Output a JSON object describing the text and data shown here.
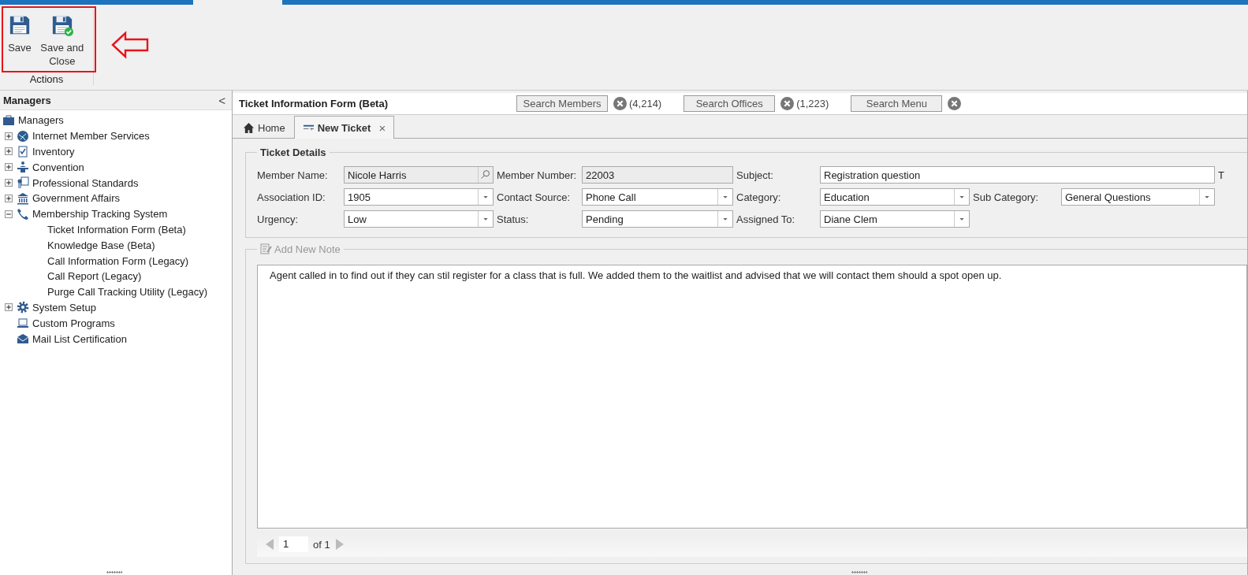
{
  "ribbon": {
    "buttons": [
      {
        "label": "Save",
        "kind": "save"
      },
      {
        "label": "Save and Close",
        "kind": "save-close"
      }
    ],
    "group_label": "Actions"
  },
  "sidebar": {
    "title": "Managers",
    "collapse_glyph": "<",
    "root": "Managers",
    "items": [
      {
        "label": "Internet Member Services",
        "expanded": false
      },
      {
        "label": "Inventory",
        "expanded": false
      },
      {
        "label": "Convention",
        "expanded": false
      },
      {
        "label": "Professional Standards",
        "expanded": false
      },
      {
        "label": "Government Affairs",
        "expanded": false
      },
      {
        "label": "Membership Tracking System",
        "expanded": true,
        "children": [
          {
            "label": "Ticket Information Form (Beta)"
          },
          {
            "label": "Knowledge Base (Beta)"
          },
          {
            "label": "Call Information Form (Legacy)"
          },
          {
            "label": "Call Report (Legacy)"
          },
          {
            "label": "Purge Call Tracking Utility (Legacy)"
          }
        ]
      },
      {
        "label": "System Setup",
        "expanded": false
      },
      {
        "label": "Custom Programs"
      },
      {
        "label": "Mail List Certification"
      }
    ]
  },
  "panel": {
    "title": "Ticket Information Form (Beta)",
    "searches": [
      {
        "label": "Search Members",
        "count": "(4,214)"
      },
      {
        "label": "Search Offices",
        "count": "(1,223)"
      },
      {
        "label": "Search Menu"
      }
    ],
    "tabs": [
      {
        "label": "Home",
        "selected": false
      },
      {
        "label": "New Ticket",
        "selected": true,
        "close_glyph": "×"
      }
    ],
    "ticket_details": {
      "title": "Ticket Details",
      "rows": [
        [
          {
            "label": "Member Name:",
            "value": "Nicole Harris",
            "kind": "lookup"
          },
          {
            "label": "Member Number:",
            "value": "22003",
            "kind": "readonly"
          },
          {
            "label": "Subject:",
            "value": "Registration question",
            "kind": "wide"
          }
        ],
        [
          {
            "label": "Association ID:",
            "value": "1905",
            "kind": "dropdown"
          },
          {
            "label": "Contact Source:",
            "value": "Phone Call",
            "kind": "dropdown"
          },
          {
            "label": "Category:",
            "value": "Education",
            "kind": "dropdown"
          },
          {
            "label": "Sub Category:",
            "value": "General Questions",
            "kind": "dropdown"
          }
        ],
        [
          {
            "label": "Urgency:",
            "value": "Low",
            "kind": "dropdown"
          },
          {
            "label": "Status:",
            "value": "Pending",
            "kind": "dropdown"
          },
          {
            "label": "Assigned To:",
            "value": "Diane Clem",
            "kind": "dropdown"
          }
        ]
      ],
      "cut_label": "T"
    },
    "note": {
      "title": "Add New Note",
      "text": "Agent called in to find out if they can stil register for a class that is full. We added them to the waitlist and advised that we will contact them should a spot open up.",
      "page": "1",
      "page_of": "of 1"
    }
  }
}
